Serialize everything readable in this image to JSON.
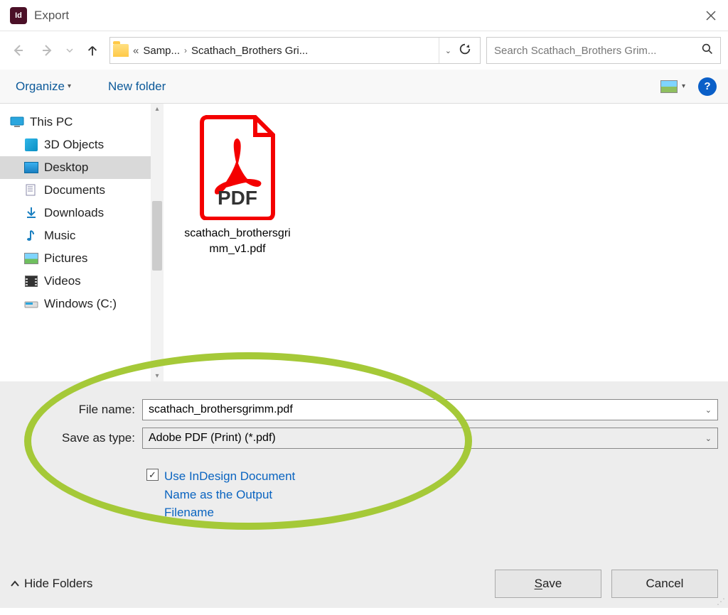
{
  "window": {
    "app_badge": "Id",
    "title": "Export"
  },
  "nav": {
    "breadcrumb": [
      "Samp...",
      "Scathach_Brothers Gri..."
    ],
    "search_placeholder": "Search Scathach_Brothers Grim..."
  },
  "toolbar": {
    "organize": "Organize",
    "new_folder": "New folder"
  },
  "sidebar": {
    "items": [
      {
        "label": "This PC",
        "icon": "thispc"
      },
      {
        "label": "3D Objects",
        "icon": "3d"
      },
      {
        "label": "Desktop",
        "icon": "desktop",
        "selected": true
      },
      {
        "label": "Documents",
        "icon": "docs"
      },
      {
        "label": "Downloads",
        "icon": "downloads"
      },
      {
        "label": "Music",
        "icon": "music"
      },
      {
        "label": "Pictures",
        "icon": "pictures"
      },
      {
        "label": "Videos",
        "icon": "videos"
      },
      {
        "label": "Windows (C:)",
        "icon": "drive"
      }
    ]
  },
  "content": {
    "files": [
      {
        "name": "scathach_brothersgrimm_v1.pdf",
        "type": "pdf"
      }
    ]
  },
  "form": {
    "file_name_label": "File name:",
    "file_name_value": "scathach_brothersgrimm.pdf",
    "save_as_type_label": "Save as type:",
    "save_as_type_value": "Adobe PDF (Print) (*.pdf)",
    "checkbox_checked": true,
    "checkbox_label": "Use InDesign Document Name as the Output Filename"
  },
  "footer": {
    "hide_folders": "Hide Folders",
    "save": "Save",
    "cancel": "Cancel"
  }
}
